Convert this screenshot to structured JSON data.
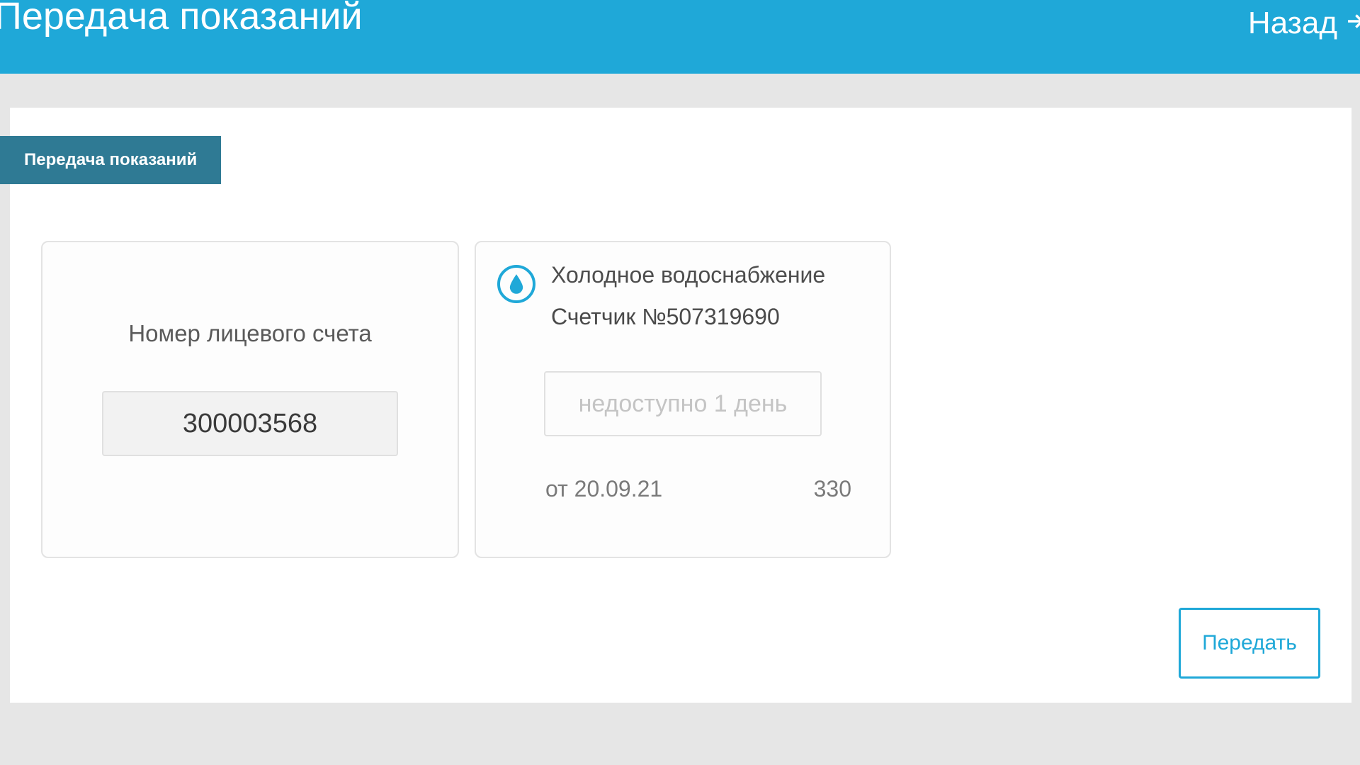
{
  "header": {
    "title": "Передача показаний",
    "back_label": "Назад"
  },
  "tab": {
    "label": "Передача показаний"
  },
  "account": {
    "label": "Номер лицевого счета",
    "value": "300003568"
  },
  "meter": {
    "title": "Холодное водоснабжение",
    "number_label": "Счетчик №507319690",
    "input_placeholder": "недоступно 1 день",
    "date_label": "от 20.09.21",
    "prev_value": "330"
  },
  "submit": {
    "label": "Передать"
  },
  "colors": {
    "primary": "#1fa8d8",
    "tab_bg": "#2f7a94"
  }
}
